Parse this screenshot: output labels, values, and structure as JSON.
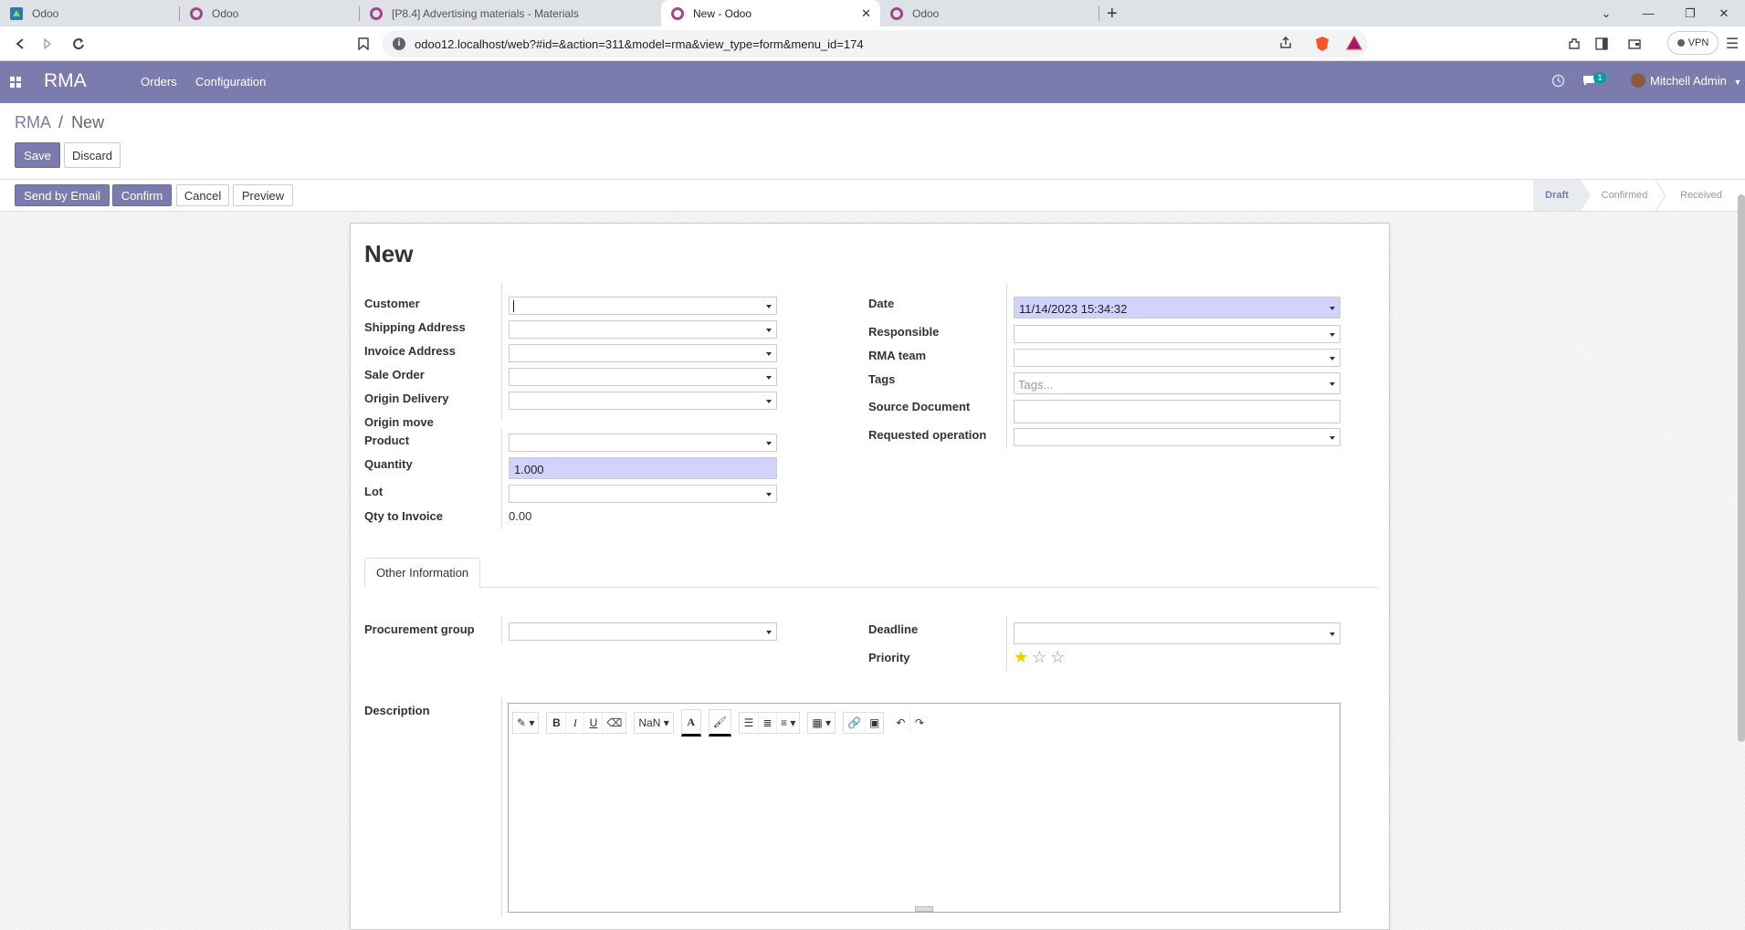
{
  "browser": {
    "tabs": [
      {
        "title": "Odoo"
      },
      {
        "title": "Odoo"
      },
      {
        "title": "[P8.4] Advertising materials - Materials"
      },
      {
        "title": "New - Odoo"
      },
      {
        "title": "Odoo"
      }
    ],
    "url": "odoo12.localhost/web?#id=&action=311&model=rma&view_type=form&menu_id=174",
    "vpn_label": "VPN",
    "window_controls": [
      "⌄",
      "—",
      "❐",
      "✕"
    ]
  },
  "navbar": {
    "app_name": "RMA",
    "menu": [
      "Orders",
      "Configuration"
    ],
    "message_count": "1",
    "user": "Mitchell Admin"
  },
  "breadcrumb": {
    "root": "RMA",
    "separator": "/",
    "current": "New"
  },
  "actions": {
    "save": "Save",
    "discard": "Discard"
  },
  "header_buttons": {
    "send_email": "Send by Email",
    "confirm": "Confirm",
    "cancel": "Cancel",
    "preview": "Preview"
  },
  "status_steps": [
    {
      "label": "Draft",
      "active": true
    },
    {
      "label": "Confirmed",
      "active": false
    },
    {
      "label": "Received",
      "active": false
    }
  ],
  "form": {
    "title": "New",
    "left_labels": {
      "customer": "Customer",
      "shipping": "Shipping Address",
      "invoice": "Invoice Address",
      "sale_order": "Sale Order",
      "origin_delivery": "Origin Delivery",
      "origin_move": "Origin move",
      "product": "Product",
      "quantity": "Quantity",
      "lot": "Lot",
      "qty_invoice": "Qty to Invoice"
    },
    "quantity_value": "1.000",
    "qty_invoice_value": "0.00",
    "right_labels": {
      "date": "Date",
      "responsible": "Responsible",
      "team": "RMA team",
      "tags": "Tags",
      "source_doc": "Source Document",
      "req_op": "Requested operation"
    },
    "date_value": "11/14/2023 15:34:32",
    "tags_placeholder": "Tags...",
    "notebook_tab": "Other Information",
    "proc_group": "Procurement group",
    "deadline": "Deadline",
    "priority": "Priority",
    "priority_stars": 1,
    "description": "Description",
    "editor_toolbar": {
      "font_size": "NaN"
    }
  },
  "colors": {
    "brand": "#7c7bad",
    "required_field": "#d2d2ff",
    "star": "#f3cc00"
  }
}
